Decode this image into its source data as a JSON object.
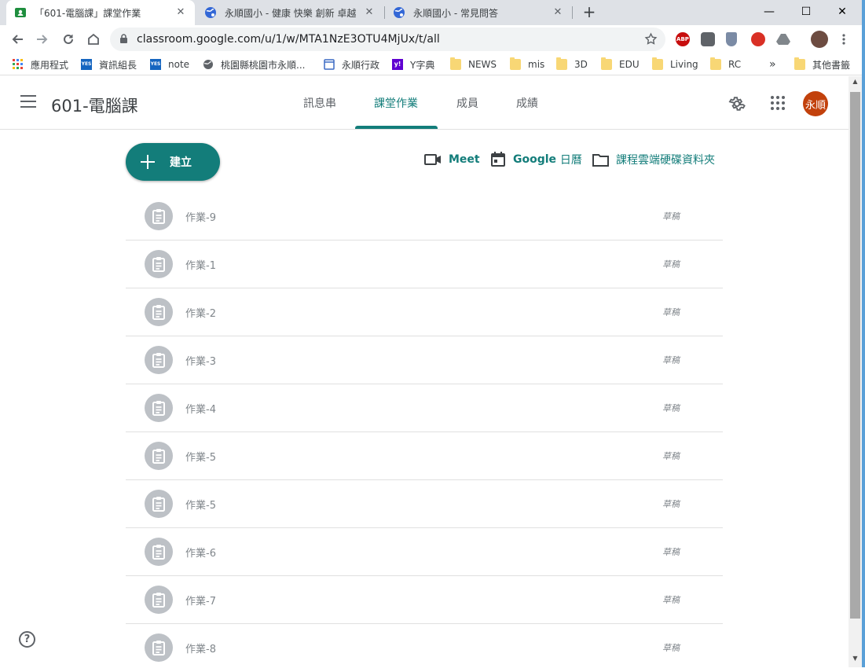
{
  "browser": {
    "tabs": [
      {
        "title": "「601-電腦課」課堂作業",
        "close": "✕"
      },
      {
        "title": "永順國小 - 健康 快樂 創新 卓越",
        "close": "✕"
      },
      {
        "title": "永順國小 - 常見問答",
        "close": "✕"
      }
    ],
    "new_tab": "+",
    "window_controls": {
      "minimize": "—",
      "maximize": "☐",
      "close": "✕"
    },
    "url": "classroom.google.com/u/1/w/MTA1NzE3OTU4MjUx/t/all",
    "extensions": [
      {
        "label": "ABP",
        "color": "#c70d0d"
      },
      {
        "label": "",
        "color": "#5f6368"
      },
      {
        "label": "",
        "color": "#7b8ba5"
      },
      {
        "label": "",
        "color": "#d93025"
      },
      {
        "label": "",
        "color": "#5f6368"
      },
      {
        "label": "",
        "color": "#6d4c41"
      }
    ]
  },
  "bookmarks": {
    "items": [
      {
        "label": "應用程式",
        "icon": "apps-grid-icon"
      },
      {
        "label": "資訊組長",
        "icon": "yes-icon"
      },
      {
        "label": "note",
        "icon": "yes-icon"
      },
      {
        "label": "桃園縣桃園市永順...",
        "icon": "globe-icon"
      },
      {
        "label": "永順行政",
        "icon": "page-icon"
      },
      {
        "label": "Y字典",
        "icon": "yahoo-icon"
      },
      {
        "label": "NEWS",
        "icon": "folder-icon"
      },
      {
        "label": "mis",
        "icon": "folder-icon"
      },
      {
        "label": "3D",
        "icon": "folder-icon"
      },
      {
        "label": "EDU",
        "icon": "folder-icon"
      },
      {
        "label": "Living",
        "icon": "folder-icon"
      },
      {
        "label": "RC",
        "icon": "folder-icon"
      }
    ],
    "more": "»",
    "other": "其他書籤",
    "yes_badge": "YES",
    "yahoo_badge": "y!"
  },
  "header": {
    "course_title": "601-電腦課",
    "tabs": [
      "訊息串",
      "課堂作業",
      "成員",
      "成績"
    ],
    "active_tab": "課堂作業",
    "avatar_text": "永順"
  },
  "actions": {
    "create_label": "建立",
    "meet_label": "Meet",
    "calendar_label_latin": "Google",
    "calendar_label_cjk": "日曆",
    "drive_label": "課程雲端硬碟資料夾"
  },
  "assignments": [
    {
      "title": "作業-9",
      "status": "草稿"
    },
    {
      "title": "作業-1",
      "status": "草稿"
    },
    {
      "title": "作業-2",
      "status": "草稿"
    },
    {
      "title": "作業-3",
      "status": "草稿"
    },
    {
      "title": "作業-4",
      "status": "草稿"
    },
    {
      "title": "作業-5",
      "status": "草稿"
    },
    {
      "title": "作業-5",
      "status": "草稿"
    },
    {
      "title": "作業-6",
      "status": "草稿"
    },
    {
      "title": "作業-7",
      "status": "草稿"
    },
    {
      "title": "作業-8",
      "status": "草稿"
    }
  ],
  "help_label": "?",
  "colors": {
    "accent": "#137d7a",
    "avatar": "#c2410c"
  }
}
